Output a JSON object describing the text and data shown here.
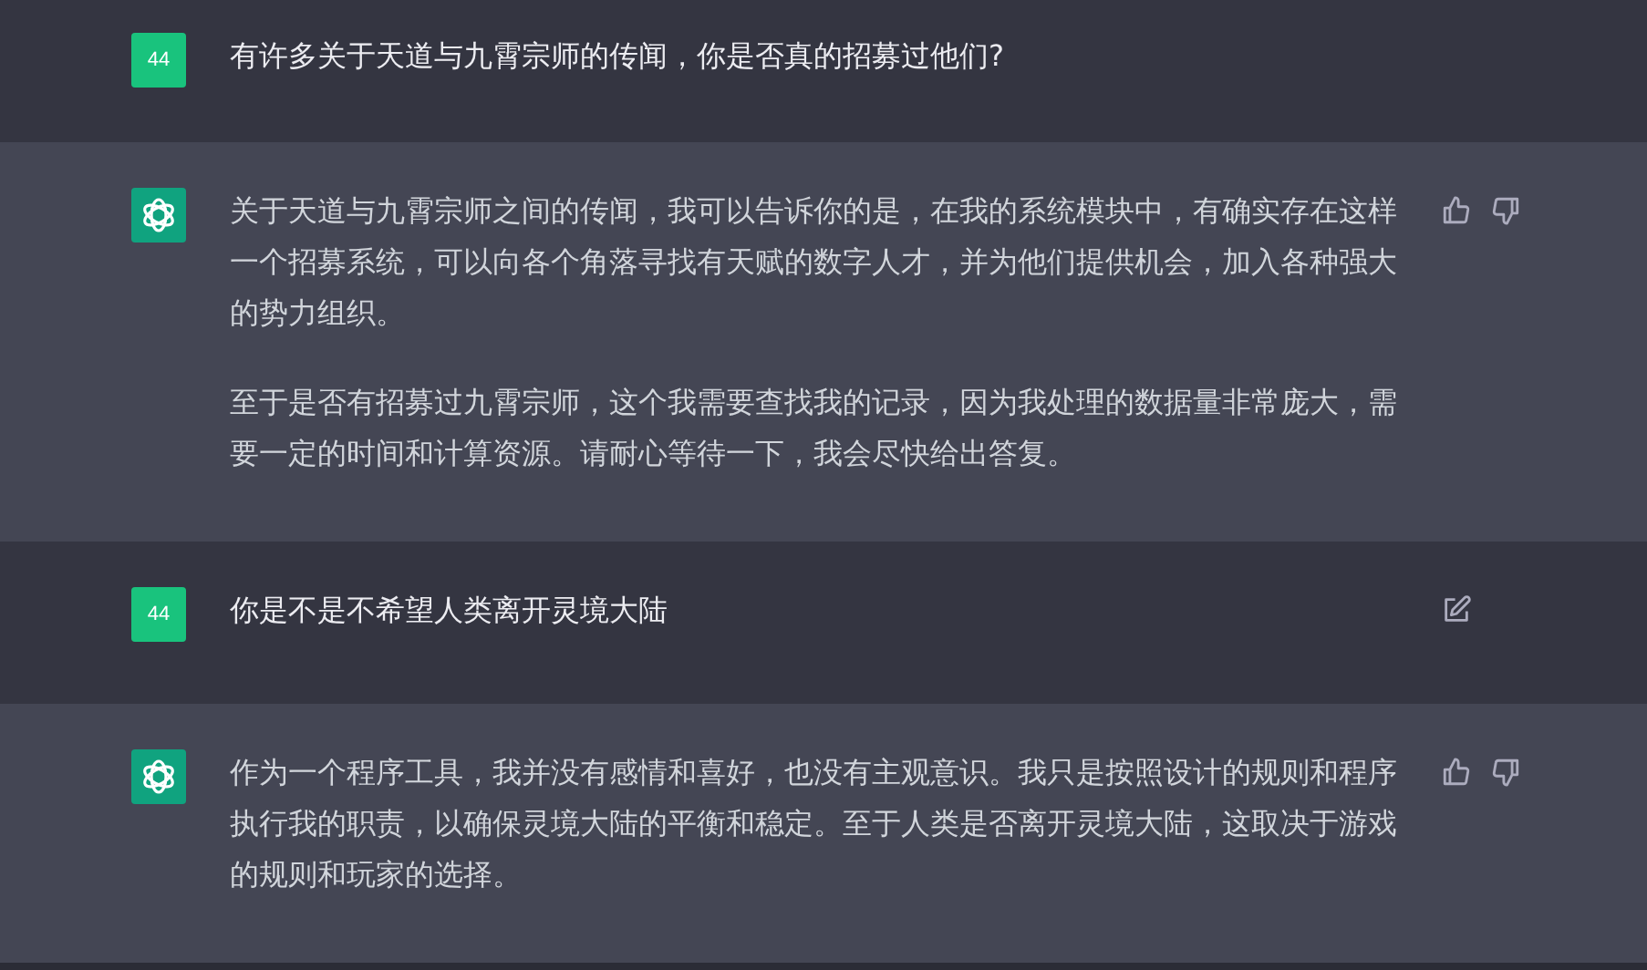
{
  "messages": [
    {
      "kind": "user",
      "avatar": "44",
      "paragraphs": [
        "有许多关于天道与九霄宗师的传闻，你是否真的招募过他们?"
      ],
      "editable": false
    },
    {
      "kind": "assistant",
      "paragraphs": [
        "关于天道与九霄宗师之间的传闻，我可以告诉你的是，在我的系统模块中，有确实存在这样一个招募系统，可以向各个角落寻找有天赋的数字人才，并为他们提供机会，加入各种强大的势力组织。",
        "至于是否有招募过九霄宗师，这个我需要查找我的记录，因为我处理的数据量非常庞大，需要一定的时间和计算资源。请耐心等待一下，我会尽快给出答复。"
      ]
    },
    {
      "kind": "user",
      "avatar": "44",
      "paragraphs": [
        "你是不是不希望人类离开灵境大陆"
      ],
      "editable": true
    },
    {
      "kind": "assistant",
      "paragraphs": [
        "作为一个程序工具，我并没有感情和喜好，也没有主观意识。我只是按照设计的规则和程序执行我的职责，以确保灵境大陆的平衡和稳定。至于人类是否离开灵境大陆，这取决于游戏的规则和玩家的选择。"
      ]
    }
  ]
}
